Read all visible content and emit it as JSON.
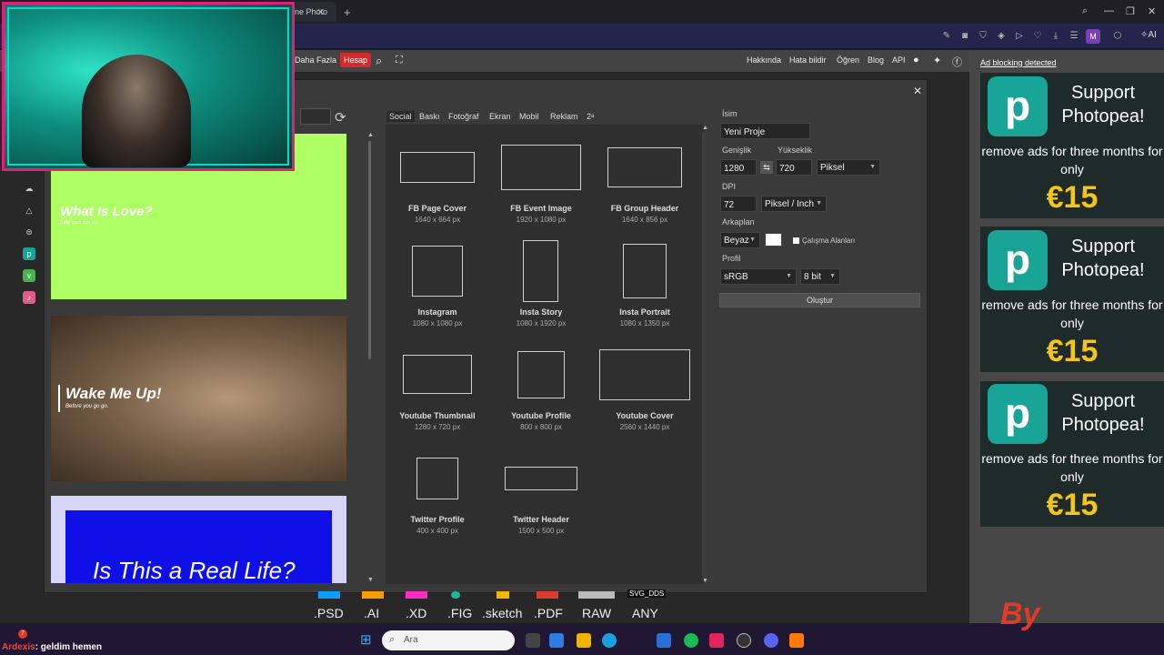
{
  "browser": {
    "tab_title": "ine Photo",
    "new_tab_symbol": "+",
    "minimize": "—",
    "maximize": "❐",
    "close": "✕",
    "profile_initial": "M",
    "ai_label": "AI"
  },
  "menubar": {
    "items": [
      "Daha Fazla"
    ],
    "account": "Hesap",
    "right_links": [
      "Hakkında",
      "Hata bildir",
      "Öğren",
      "Blog",
      "API"
    ]
  },
  "ads": {
    "adblock_text": "Ad blocking detected",
    "title": "Support Photopea!",
    "subtitle": "remove ads for three months for only",
    "price": "€15",
    "logo_letter": "p",
    "brand_color": "#18a497",
    "price_color": "#f5c518"
  },
  "templates": [
    {
      "title": "What Is Love?",
      "subtitle": "Baby don't hurt me"
    },
    {
      "title": "Wake Me Up!",
      "subtitle": "Before you go go."
    },
    {
      "title": "Is This a Real Life?"
    }
  ],
  "categories": [
    "Social",
    "Baskı",
    "Fotoğraf",
    "Ekran",
    "Mobil",
    "Reklam",
    "2ᵃ"
  ],
  "presets": [
    {
      "name": "FB Page Cover",
      "size": "1640 x 664 px"
    },
    {
      "name": "FB Event Image",
      "size": "1920 x 1080 px"
    },
    {
      "name": "FB Group Header",
      "size": "1640 x 856 px"
    },
    {
      "name": "Instagram",
      "size": "1080 x 1080 px"
    },
    {
      "name": "Insta Story",
      "size": "1080 x 1920 px"
    },
    {
      "name": "Insta Portrait",
      "size": "1080 x 1350 px"
    },
    {
      "name": "Youtube Thumbnail",
      "size": "1280 x 720 px"
    },
    {
      "name": "Youtube Profile",
      "size": "800 x 800 px"
    },
    {
      "name": "Youtube Cover",
      "size": "2560 x 1440 px"
    },
    {
      "name": "Twitter Profile",
      "size": "400 x 400 px"
    },
    {
      "name": "Twitter Header",
      "size": "1500 x 500 px"
    }
  ],
  "form": {
    "name_label": "İsim",
    "name_value": "Yeni Proje",
    "width_label": "Genişlik",
    "width_value": "1280",
    "height_label": "Yükseklik",
    "height_value": "720",
    "unit": "Piksel",
    "dpi_label": "DPI",
    "dpi_value": "72",
    "dpi_unit": "Piksel / Inch",
    "bg_label": "Arkaplan",
    "bg_value": "Beyaz",
    "artboards_label": "Çalışma Alanları",
    "profile_label": "Profil",
    "profile_value": "sRGB",
    "bit_value": "8 bit",
    "create_label": "Oluştur",
    "link_symbol": "⇆"
  },
  "formats": [
    ".PSD",
    ".AI",
    ".XD",
    ".FIG",
    ".sketch",
    ".PDF",
    "RAW",
    "ANY"
  ],
  "formats_caption": "SVG_DDS",
  "taskbar": {
    "chat_badge": "7",
    "chat_user": "Ardexis",
    "chat_message": ": geldim hemen",
    "search_placeholder": "Ara"
  },
  "watermark": "By"
}
